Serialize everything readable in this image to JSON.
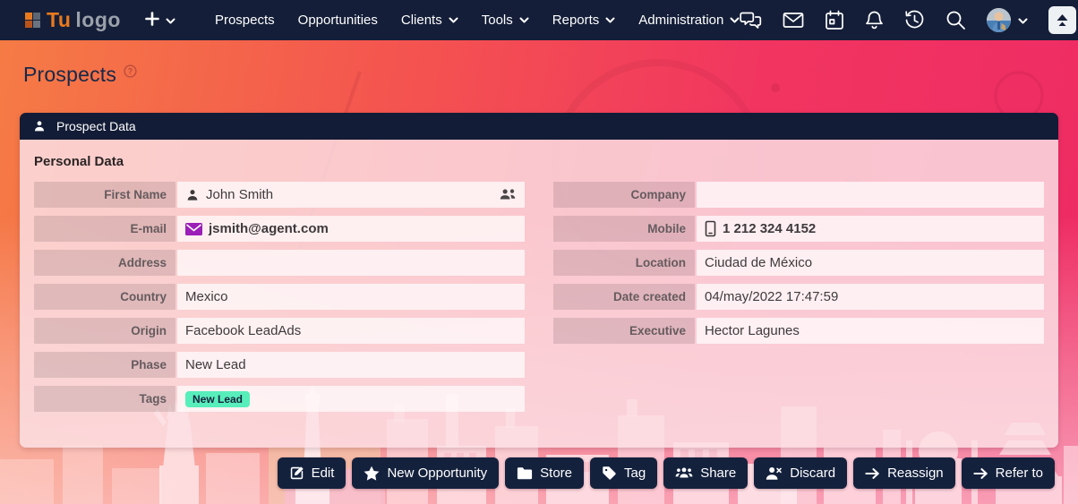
{
  "navbar": {
    "logo": {
      "text_primary": "Tu",
      "text_secondary": "logo"
    },
    "quick_add": {
      "icon": "plus-icon"
    },
    "items": [
      {
        "label": "Prospects",
        "dropdown": false
      },
      {
        "label": "Opportunities",
        "dropdown": false
      },
      {
        "label": "Clients",
        "dropdown": true
      },
      {
        "label": "Tools",
        "dropdown": true
      },
      {
        "label": "Reports",
        "dropdown": true
      },
      {
        "label": "Administration",
        "dropdown": true
      }
    ],
    "action_icons": [
      "chat-icon",
      "mail-icon",
      "calendar-icon",
      "bell-icon",
      "history-icon",
      "search-icon"
    ],
    "user_menu": {
      "avatar": "user-avatar",
      "dropdown": true
    },
    "scroll_top": {
      "icon": "collapse-up-icon"
    }
  },
  "page": {
    "title": "Prospects",
    "help_icon": "help-icon"
  },
  "card": {
    "header": {
      "icon": "person-icon",
      "title": "Prospect Data"
    },
    "section_title": "Personal Data",
    "left_fields": [
      {
        "label": "First Name",
        "value": "John Smith",
        "icon": "person-icon",
        "trailing_icon": "people-icon"
      },
      {
        "label": "E-mail",
        "value": "jsmith@agent.com",
        "icon": "envelope-icon",
        "icon_color": "#9c1fb8",
        "bold": true,
        "link": true
      },
      {
        "label": "Address",
        "value": ""
      },
      {
        "label": "Country",
        "value": "Mexico"
      },
      {
        "label": "Origin",
        "value": "Facebook LeadAds"
      },
      {
        "label": "Phase",
        "value": "New Lead"
      },
      {
        "label": "Tags",
        "value": "",
        "tag": {
          "label": "New Lead",
          "color": "#57eebb"
        }
      }
    ],
    "right_fields": [
      {
        "label": "Company",
        "value": ""
      },
      {
        "label": "Mobile",
        "value": "1 212 324 4152",
        "icon": "mobile-icon",
        "bold": true,
        "link": true
      },
      {
        "label": "Location",
        "value": "Ciudad de México"
      },
      {
        "label": "Date created",
        "value": "04/may/2022 17:47:59"
      },
      {
        "label": "Executive",
        "value": "Hector Lagunes"
      }
    ]
  },
  "actions": [
    {
      "label": "Edit",
      "icon": "edit-icon"
    },
    {
      "label": "New Opportunity",
      "icon": "star-icon"
    },
    {
      "label": "Store",
      "icon": "folder-icon"
    },
    {
      "label": "Tag",
      "icon": "tag-icon"
    },
    {
      "label": "Share",
      "icon": "share-icon"
    },
    {
      "label": "Discard",
      "icon": "person-remove-icon"
    },
    {
      "label": "Reassign",
      "icon": "arrow-right-icon"
    },
    {
      "label": "Refer to",
      "icon": "arrow-right-icon"
    }
  ],
  "colors": {
    "navbar_bg": "#141e38",
    "card_header_bg": "#131c36",
    "button_bg": "#14213d",
    "gradient_start": "#f57b45",
    "gradient_end": "#ee2b64",
    "tag_color": "#57eebb",
    "email_icon_color": "#9c1fb8",
    "logo_orange": "#e87a1e"
  }
}
